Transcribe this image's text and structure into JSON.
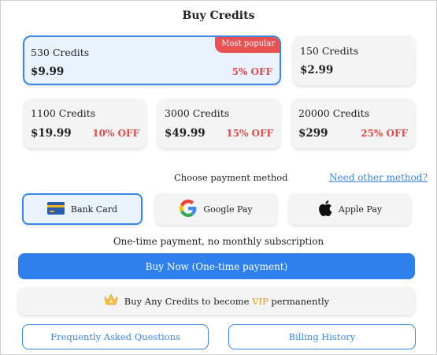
{
  "title": "Buy Credits",
  "packages": [
    {
      "credits": "530 Credits",
      "price": "$9.99",
      "discount": "5% OFF",
      "badge": "Most popular",
      "selected": true
    },
    {
      "credits": "150 Credits",
      "price": "$2.99",
      "discount": "",
      "badge": "",
      "selected": false
    },
    {
      "credits": "1100 Credits",
      "price": "$19.99",
      "discount": "10% OFF",
      "badge": "",
      "selected": false
    },
    {
      "credits": "3000 Credits",
      "price": "$49.99",
      "discount": "15% OFF",
      "badge": "",
      "selected": false
    },
    {
      "credits": "20000 Credits",
      "price": "$299",
      "discount": "25% OFF",
      "badge": "",
      "selected": false
    }
  ],
  "payment": {
    "label": "Choose payment method",
    "other_link": "Need other method?",
    "methods": [
      {
        "label": "Bank Card",
        "icon": "bank-card-icon",
        "selected": true
      },
      {
        "label": "Google Pay",
        "icon": "google-icon",
        "selected": false
      },
      {
        "label": "Apple Pay",
        "icon": "apple-icon",
        "selected": false
      }
    ]
  },
  "notice": "One-time payment, no monthly subscription",
  "buy_now": "Buy Now (One-time payment)",
  "vip": {
    "prefix": "Buy Any Credits to become ",
    "highlight": "VIP",
    "suffix": " permanently",
    "icon": "crown-icon"
  },
  "footer": {
    "faq": "Frequently Asked Questions",
    "billing": "Billing History"
  },
  "colors": {
    "accent": "#2f80ed",
    "discount": "#e04c4c",
    "badge": "#e85252",
    "vip": "#e69a1a",
    "selected_bg": "#eaf2fd"
  }
}
